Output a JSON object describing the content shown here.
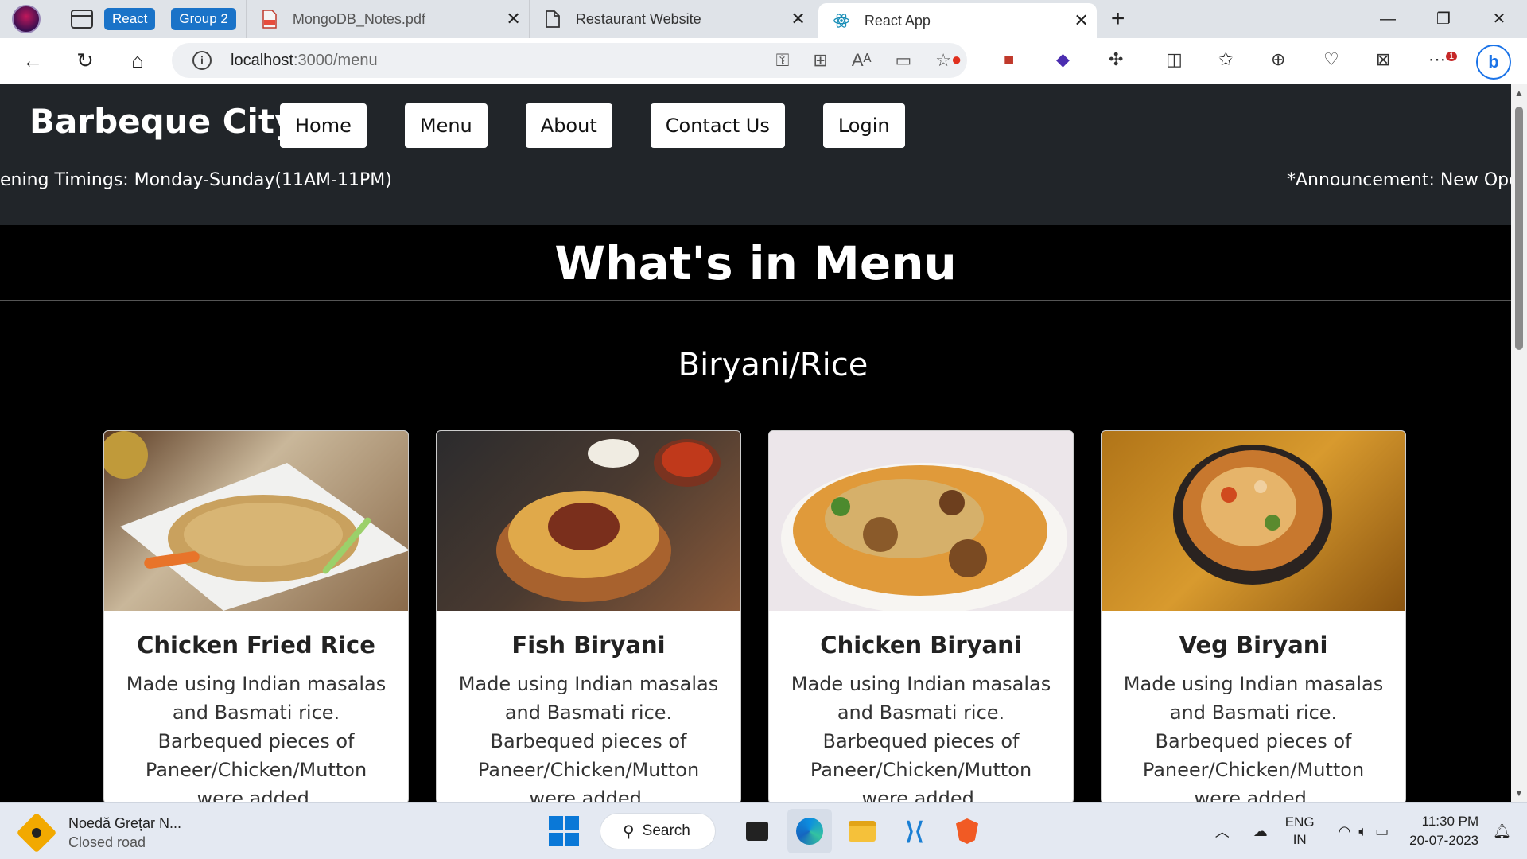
{
  "browser": {
    "tab_groups": [
      "React",
      "Group 2"
    ],
    "tabs": [
      {
        "title": "MongoDB_Notes.pdf",
        "icon": "pdf-icon",
        "active": false
      },
      {
        "title": "Restaurant Website",
        "icon": "document-icon",
        "active": false
      },
      {
        "title": "React App",
        "icon": "react-icon",
        "active": true
      }
    ],
    "url_host": "localhost",
    "url_path": ":3000/menu"
  },
  "site": {
    "brand": "Barbeque City",
    "nav": [
      "Home",
      "Menu",
      "About",
      "Contact Us",
      "Login"
    ],
    "ticker_left": "ening Timings: Monday-Sunday(11AM-11PM)",
    "ticker_right": "*Announcement: New Ope",
    "heading": "What's in Menu",
    "section": "Biryani/Rice",
    "items": [
      {
        "name": "Chicken Fried Rice",
        "desc": "Made using Indian masalas and Basmati rice. Barbequed pieces of Paneer/Chicken/Mutton were added."
      },
      {
        "name": "Fish Biryani",
        "desc": "Made using Indian masalas and Basmati rice. Barbequed pieces of Paneer/Chicken/Mutton were added."
      },
      {
        "name": "Chicken Biryani",
        "desc": "Made using Indian masalas and Basmati rice. Barbequed pieces of Paneer/Chicken/Mutton were added."
      },
      {
        "name": "Veg Biryani",
        "desc": "Made using Indian masalas and Basmati rice. Barbequed pieces of Paneer/Chicken/Mutton were added."
      }
    ]
  },
  "taskbar": {
    "weather_title": "Noedă Grețar N...",
    "weather_sub": "Closed road",
    "search": "Search",
    "lang_1": "ENG",
    "lang_2": "IN",
    "time": "11:30 PM",
    "date": "20-07-2023",
    "notification_badge": "1"
  }
}
